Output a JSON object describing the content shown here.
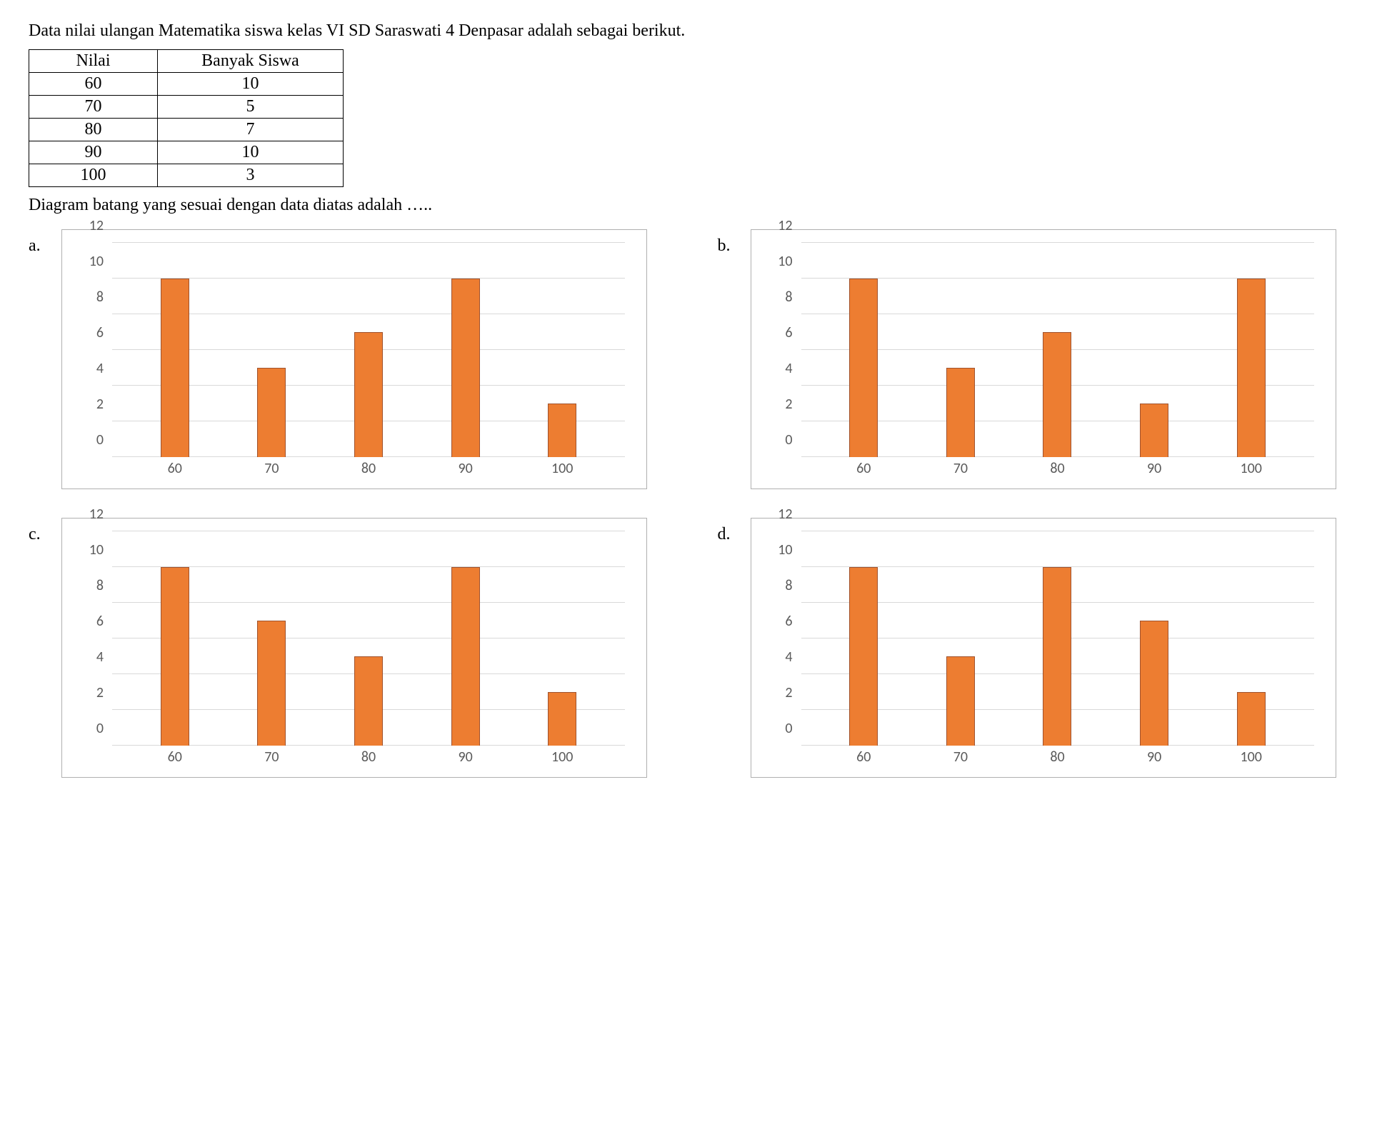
{
  "intro_text": "Data nilai ulangan Matematika siswa kelas VI SD Saraswati 4 Denpasar adalah sebagai berikut.",
  "table": {
    "header": {
      "nilai": "Nilai",
      "siswa": "Banyak Siswa"
    },
    "rows": [
      {
        "nilai": "60",
        "siswa": "10"
      },
      {
        "nilai": "70",
        "siswa": "5"
      },
      {
        "nilai": "80",
        "siswa": "7"
      },
      {
        "nilai": "90",
        "siswa": "10"
      },
      {
        "nilai": "100",
        "siswa": "3"
      }
    ]
  },
  "question_text": "Diagram batang yang sesuai dengan data diatas adalah …..",
  "y_axis": {
    "ticks": [
      0,
      2,
      4,
      6,
      8,
      10,
      12
    ],
    "max": 12
  },
  "options": [
    {
      "label": "a.",
      "categories": [
        "60",
        "70",
        "80",
        "90",
        "100"
      ],
      "values": [
        10,
        5,
        7,
        10,
        3
      ]
    },
    {
      "label": "b.",
      "categories": [
        "60",
        "70",
        "80",
        "90",
        "100"
      ],
      "values": [
        10,
        5,
        7,
        3,
        10
      ]
    },
    {
      "label": "c.",
      "categories": [
        "60",
        "70",
        "80",
        "90",
        "100"
      ],
      "values": [
        10,
        7,
        5,
        10,
        3
      ]
    },
    {
      "label": "d.",
      "categories": [
        "60",
        "70",
        "80",
        "90",
        "100"
      ],
      "values": [
        10,
        5,
        10,
        7,
        3
      ]
    }
  ],
  "chart_data": [
    {
      "type": "bar",
      "option": "a",
      "categories": [
        "60",
        "70",
        "80",
        "90",
        "100"
      ],
      "values": [
        10,
        5,
        7,
        10,
        3
      ],
      "xlabel": "",
      "ylabel": "",
      "title": "",
      "ylim": [
        0,
        12
      ],
      "y_ticks": [
        0,
        2,
        4,
        6,
        8,
        10,
        12
      ]
    },
    {
      "type": "bar",
      "option": "b",
      "categories": [
        "60",
        "70",
        "80",
        "90",
        "100"
      ],
      "values": [
        10,
        5,
        7,
        3,
        10
      ],
      "xlabel": "",
      "ylabel": "",
      "title": "",
      "ylim": [
        0,
        12
      ],
      "y_ticks": [
        0,
        2,
        4,
        6,
        8,
        10,
        12
      ]
    },
    {
      "type": "bar",
      "option": "c",
      "categories": [
        "60",
        "70",
        "80",
        "90",
        "100"
      ],
      "values": [
        10,
        7,
        5,
        10,
        3
      ],
      "xlabel": "",
      "ylabel": "",
      "title": "",
      "ylim": [
        0,
        12
      ],
      "y_ticks": [
        0,
        2,
        4,
        6,
        8,
        10,
        12
      ]
    },
    {
      "type": "bar",
      "option": "d",
      "categories": [
        "60",
        "70",
        "80",
        "90",
        "100"
      ],
      "values": [
        10,
        5,
        10,
        7,
        3
      ],
      "xlabel": "",
      "ylabel": "",
      "title": "",
      "ylim": [
        0,
        12
      ],
      "y_ticks": [
        0,
        2,
        4,
        6,
        8,
        10,
        12
      ]
    }
  ],
  "colors": {
    "bar_fill": "#ed7d31",
    "bar_border": "#a0522d",
    "gridline": "#d9d9d9",
    "axis_text": "#5a5a5a"
  }
}
